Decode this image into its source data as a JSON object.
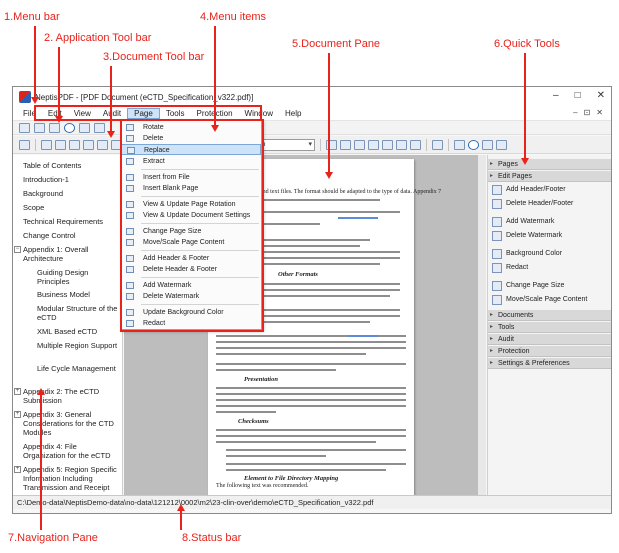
{
  "annotations": {
    "menu_bar": "1.Menu bar",
    "app_toolbar": "2. Application Tool bar",
    "doc_toolbar": "3.Document Tool bar",
    "menu_items": "4.Menu items",
    "doc_pane": "5.Document Pane",
    "quick_tools": "6.Quick Tools",
    "nav_pane": "7.Navigation Pane",
    "status_bar": "8.Status bar"
  },
  "window": {
    "title": "NeptisPDF - [PDF Document (eCTD_Specification_v322.pdf)]",
    "minimize": "–",
    "maximize": "□",
    "close": "✕",
    "mdi_controls": [
      "–",
      "⊡",
      "✕"
    ]
  },
  "menubar": {
    "items": [
      "File",
      "Edit",
      "View",
      "Audit",
      "Page",
      "Tools",
      "Protection",
      "Window",
      "Help"
    ]
  },
  "doctoolbar": {
    "zoom": "Custom"
  },
  "page_menu": {
    "items": [
      "Rotate",
      "Delete",
      "Replace",
      "Extract",
      "Insert from File",
      "Insert Blank Page",
      "View & Update Page Rotation",
      "View & Update Document Settings",
      "Change Page Size",
      "Move/Scale Page Content",
      "Add Header & Footer",
      "Delete Header & Footer",
      "Add Watermark",
      "Delete Watermark",
      "Update Background Color",
      "Redact"
    ]
  },
  "navigation": {
    "items": [
      "Table of Contents",
      "Introduction-1",
      "Background",
      "Scope",
      "Technical Requirements",
      "Change Control",
      "Appendix 1: Overall Architecture",
      "Guiding Design Principles",
      "Business Model",
      "Modular Structure of the eCTD",
      "XML Based eCTD",
      "Multiple Region Support",
      "Life Cycle Management",
      "Appendix 2: The eCTD Submission",
      "Appendix 3: General Considerations for the CTD Modules",
      "Appendix 4: File Organization for the eCTD",
      "Appendix 5: Region Specific Information Including Transmission and Receipt",
      "Appendix 6: The eCTD XML Submission",
      "Appendix 7: Specification"
    ]
  },
  "quick_tools": {
    "sections": [
      "Pages",
      "Edit Pages",
      "Documents",
      "Tools",
      "Audit",
      "Protection",
      "Settings & Preferences"
    ],
    "edit_pages_items": [
      "Add Header/Footer",
      "Delete Header/Footer",
      "Add Watermark",
      "Delete Watermark",
      "Background Color",
      "Redact",
      "Change Page Size",
      "Move/Scale Page Content"
    ]
  },
  "document": {
    "headings": [
      "Other Formats",
      "Presentation",
      "Checksums",
      "Element to File Directory Mapping"
    ],
    "footer": "Page 2-2",
    "snippets": [
      "and text files. The format should be adapted to the type of data. Appendix 7",
      "The submitter should be included in an eCTD submission are:",
      "The following text was recommended."
    ]
  },
  "statusbar": {
    "path": "C:\\Demo-data\\NeptisDemo-data\\no-data\\121212\\0002\\m2\\23-clin-over\\demo\\eCTD_Specification_v322.pdf"
  },
  "colors": {
    "annotation": "#e8231c",
    "highlight": "#cfe3f8"
  }
}
